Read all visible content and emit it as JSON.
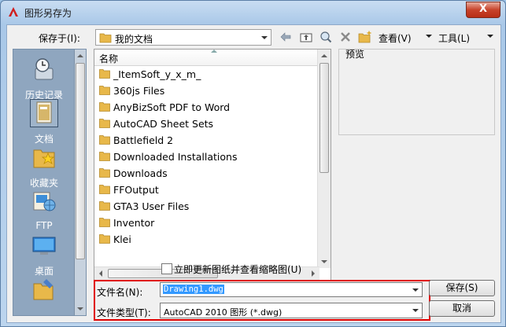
{
  "window": {
    "title": "图形另存为",
    "close_label": "X"
  },
  "toolbar": {
    "save_in_label": "保存于(I):",
    "location_value": "我的文档",
    "view_label": "查看(V)",
    "tools_label": "工具(L)"
  },
  "places": [
    {
      "label": "历史记录",
      "icon": "history-icon"
    },
    {
      "label": "文档",
      "icon": "documents-icon"
    },
    {
      "label": "收藏夹",
      "icon": "favorites-icon"
    },
    {
      "label": "FTP",
      "icon": "ftp-icon"
    },
    {
      "label": "桌面",
      "icon": "desktop-icon"
    }
  ],
  "file_list": {
    "column_header": "名称",
    "items": [
      "_ItemSoft_y_x_m_",
      "360js Files",
      "AnyBizSoft PDF to Word",
      "AutoCAD Sheet Sets",
      "Battlefield 2",
      "Downloaded Installations",
      "Downloads",
      "FFOutput",
      "GTA3 User Files",
      "Inventor",
      "Klei"
    ]
  },
  "preview": {
    "label": "预览"
  },
  "options": {
    "update_thumbnail_label": "立即更新图纸并查看缩略图(U)"
  },
  "form": {
    "filename_label": "文件名(N):",
    "filename_value": "Drawing1.dwg",
    "filetype_label": "文件类型(T):",
    "filetype_value": "AutoCAD 2010 图形 (*.dwg)"
  },
  "buttons": {
    "save_label": "保存(S)",
    "cancel_label": "取消"
  },
  "colors": {
    "highlight_box": "#e00000",
    "selection": "#3399ff",
    "folder": "#e8b84a"
  }
}
